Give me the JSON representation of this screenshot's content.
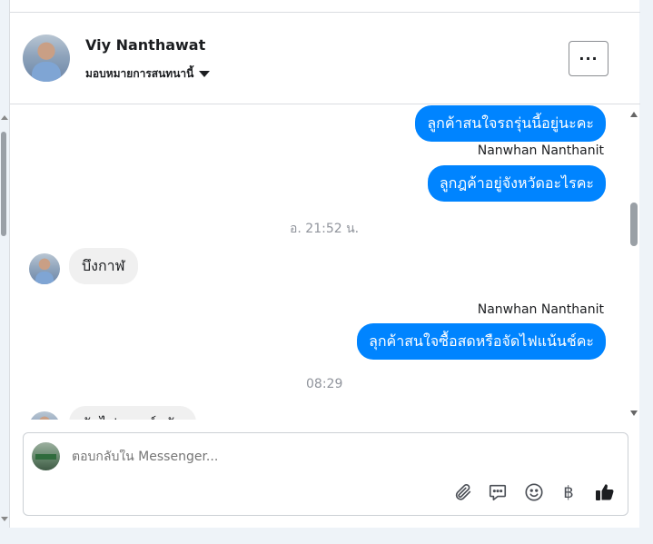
{
  "header": {
    "contact_name": "Viy Nanthawat",
    "assign_label": "มอบหมายการสนทนานี้",
    "more_label": "···"
  },
  "messages": [
    {
      "type": "out",
      "text": "ลูกค้าสนใจรถรุ่นนี้อยู่นะคะ"
    },
    {
      "type": "sender",
      "text": "Nanwhan Nanthanit"
    },
    {
      "type": "out",
      "text": "ลูกฎค้าอยู่จังหวัดอะไรคะ"
    },
    {
      "type": "time",
      "text": "อ. 21:52 น."
    },
    {
      "type": "in",
      "text": "บึงกาฬ"
    },
    {
      "type": "sender",
      "text": "Nanwhan Nanthanit"
    },
    {
      "type": "out",
      "text": "ลุกค้าสนใจซื้อสดหรือจัดไฟแน้นช์คะ"
    },
    {
      "type": "time",
      "text": "08:29"
    },
    {
      "type": "in",
      "text": "จัดไฟแนนซ์ครับ"
    }
  ],
  "composer": {
    "placeholder": "ตอบกลับใน Messenger...",
    "currency_symbol": "฿"
  },
  "icons": {
    "attach": "paperclip-icon",
    "saved_replies": "chat-bubble-icon",
    "emoji": "smiley-icon",
    "payment": "baht-icon",
    "like": "thumbs-up-icon"
  },
  "colors": {
    "outgoing_bubble": "#0084ff",
    "incoming_bubble": "#f0f0f0",
    "timestamp": "#90949c"
  }
}
